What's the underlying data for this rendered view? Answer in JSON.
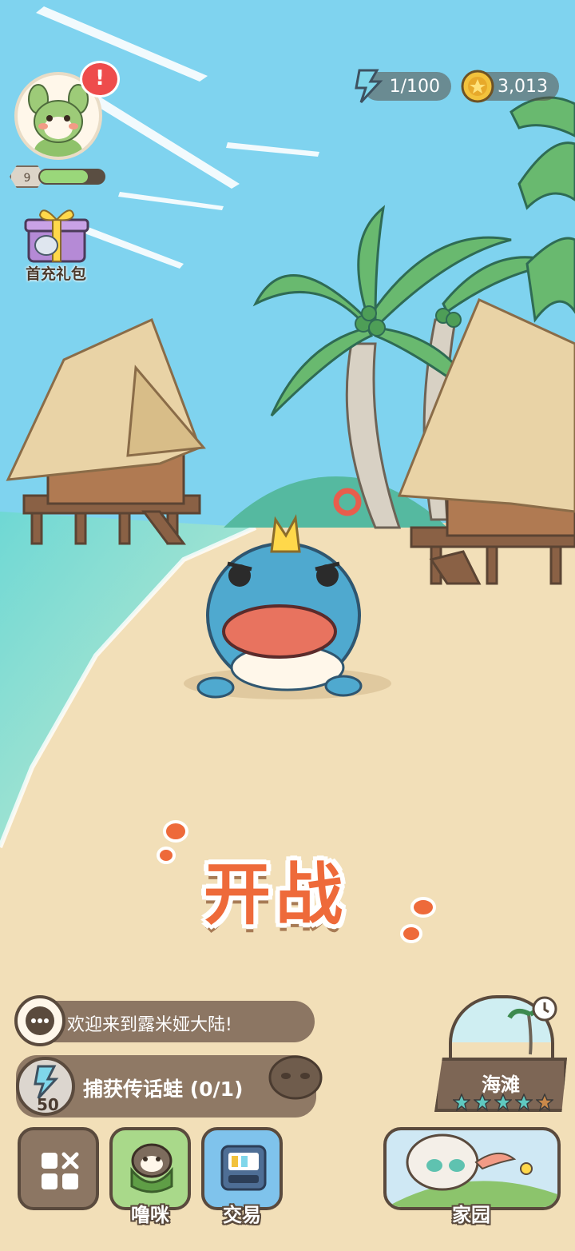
{
  "hud": {
    "energy": "1/100",
    "coins": "3,013",
    "player_level": "9",
    "level_progress": 0.75,
    "alert_mark": "!"
  },
  "gift": {
    "label": "首充礼包"
  },
  "battle": {
    "label": "开战"
  },
  "chat": {
    "message": "欢迎来到露米娅大陆!"
  },
  "quest": {
    "title": "捕获传话蛙 (0/1)",
    "reward": "50"
  },
  "location": {
    "name": "海滩",
    "stars": 5
  },
  "nav": {
    "pet_label": "噜咪",
    "trade_label": "交易",
    "home_label": "家园"
  },
  "colors": {
    "sky": "#7fd3ef",
    "sand": "#f2dfb8",
    "accent": "#ee6a3a",
    "panel": "#8c7663"
  },
  "icons": [
    "energy-bolt-icon",
    "coin-icon",
    "alert-icon",
    "gift-box-icon",
    "chat-bubble-icon",
    "quest-bolt-icon",
    "clock-icon",
    "menu-grid-icon",
    "pet-icon",
    "trade-icon",
    "home-icon",
    "star-icon"
  ]
}
